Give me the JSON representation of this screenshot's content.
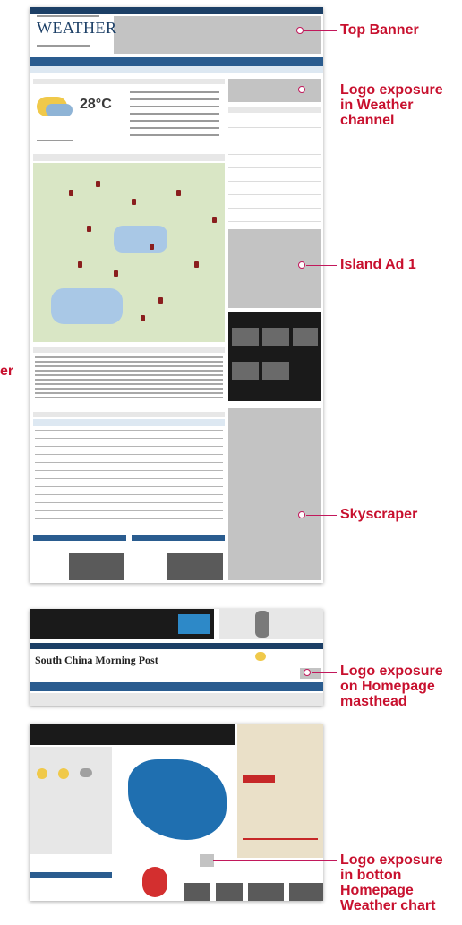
{
  "callouts": {
    "top_banner": "Top Banner",
    "logo_weather": "Logo exposure\nin Weather\nchannel",
    "island_ad": "Island Ad 1",
    "skyscraper": "Skyscraper",
    "logo_masthead": "Logo exposure\non Homepage\nmasthead",
    "logo_bottom": "Logo exposure\nin botton\nHomepage\nWeather chart",
    "cropped_left": "er"
  },
  "weather_page": {
    "logo": "WEATHER",
    "temperature": "28°C"
  },
  "homepage": {
    "masthead_title": "South China Morning Post"
  },
  "colors": {
    "callout": "#c8102e",
    "nav_blue": "#2a5c8f",
    "ad_gray": "#c3c3c3"
  }
}
